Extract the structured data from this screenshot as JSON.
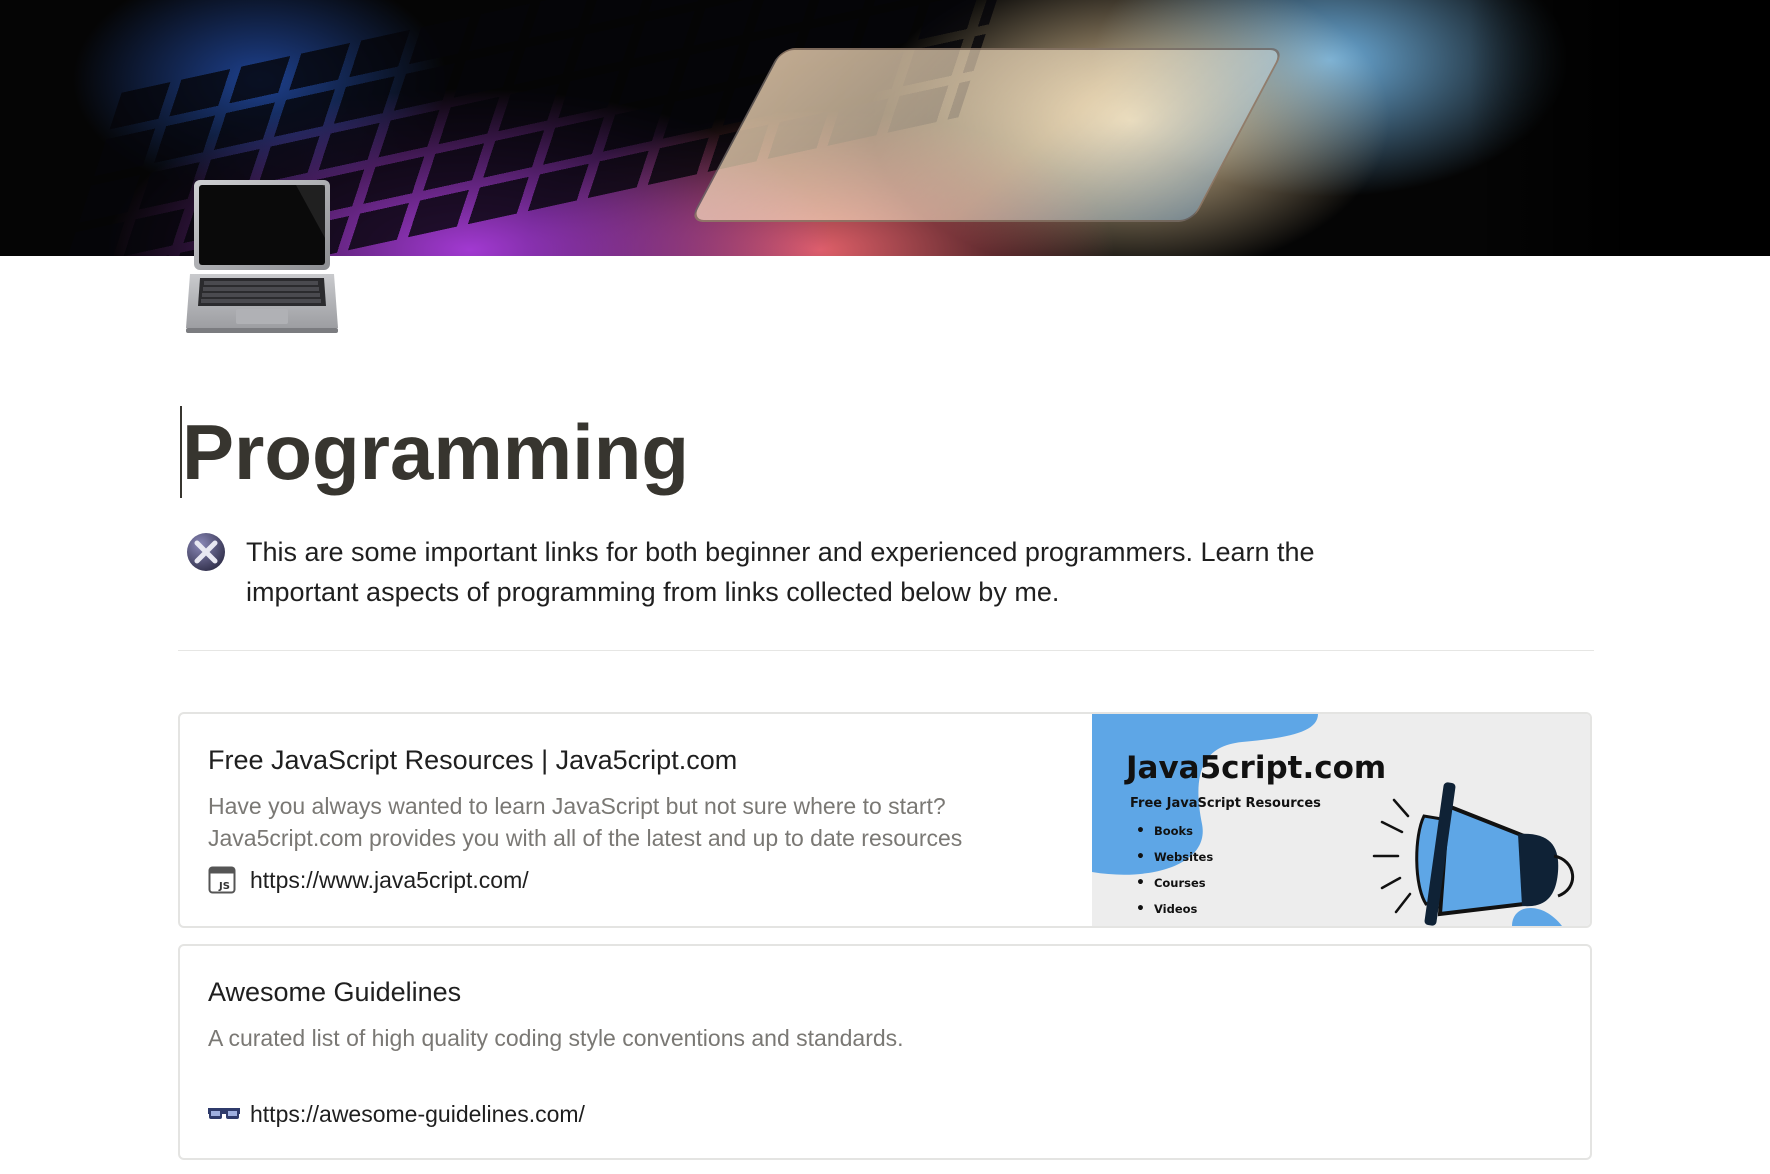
{
  "page": {
    "title": "Programming",
    "icon": "laptop-icon"
  },
  "callout": {
    "icon": "x-mark-icon",
    "text": "This are some important links for both beginner and experienced programmers. Learn the important aspects of programming from links collected below by me."
  },
  "bookmarks": [
    {
      "title": "Free JavaScript Resources | Java5cript.com",
      "description": "Have you always wanted to learn JavaScript but not sure where to start? Java5cript.com provides you with all of the latest and up to date resources",
      "url": "https://www.java5cript.com/",
      "favicon": "js-favicon-icon",
      "preview": {
        "brand": "Java5cript.com",
        "subtitle": "Free JavaScript Resources",
        "items": [
          "Books",
          "Websites",
          "Courses",
          "Videos"
        ],
        "accent": "#5ea6e6",
        "icon": "megaphone-icon"
      }
    },
    {
      "title": "Awesome Guidelines",
      "description": "A curated list of high quality coding style conventions and standards.",
      "url": "https://awesome-guidelines.com/",
      "favicon": "glasses-favicon-icon"
    }
  ],
  "colors": {
    "text": "#37352f",
    "muted": "#7a7874",
    "border": "#e4e4e2"
  }
}
